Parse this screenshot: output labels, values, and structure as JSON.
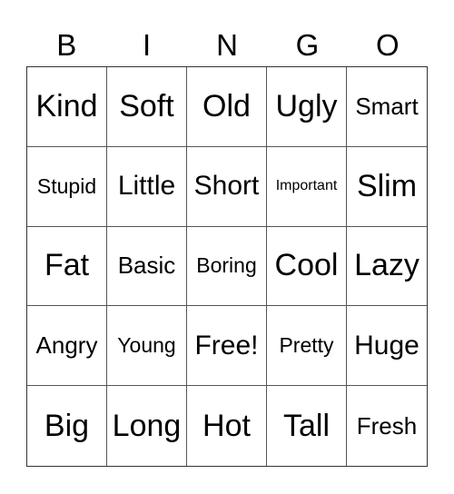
{
  "header": [
    "B",
    "I",
    "N",
    "G",
    "O"
  ],
  "cells": [
    {
      "text": "Kind",
      "size": "xl"
    },
    {
      "text": "Soft",
      "size": "xl"
    },
    {
      "text": "Old",
      "size": "xl"
    },
    {
      "text": "Ugly",
      "size": "xl"
    },
    {
      "text": "Smart",
      "size": "m"
    },
    {
      "text": "Stupid",
      "size": "s"
    },
    {
      "text": "Little",
      "size": "l"
    },
    {
      "text": "Short",
      "size": "l"
    },
    {
      "text": "Important",
      "size": "xs"
    },
    {
      "text": "Slim",
      "size": "xl"
    },
    {
      "text": "Fat",
      "size": "xl"
    },
    {
      "text": "Basic",
      "size": "m"
    },
    {
      "text": "Boring",
      "size": "s"
    },
    {
      "text": "Cool",
      "size": "xl"
    },
    {
      "text": "Lazy",
      "size": "xl"
    },
    {
      "text": "Angry",
      "size": "m"
    },
    {
      "text": "Young",
      "size": "s"
    },
    {
      "text": "Free!",
      "size": "l"
    },
    {
      "text": "Pretty",
      "size": "s"
    },
    {
      "text": "Huge",
      "size": "l"
    },
    {
      "text": "Big",
      "size": "xl"
    },
    {
      "text": "Long",
      "size": "xl"
    },
    {
      "text": "Hot",
      "size": "xl"
    },
    {
      "text": "Tall",
      "size": "xl"
    },
    {
      "text": "Fresh",
      "size": "m"
    }
  ]
}
